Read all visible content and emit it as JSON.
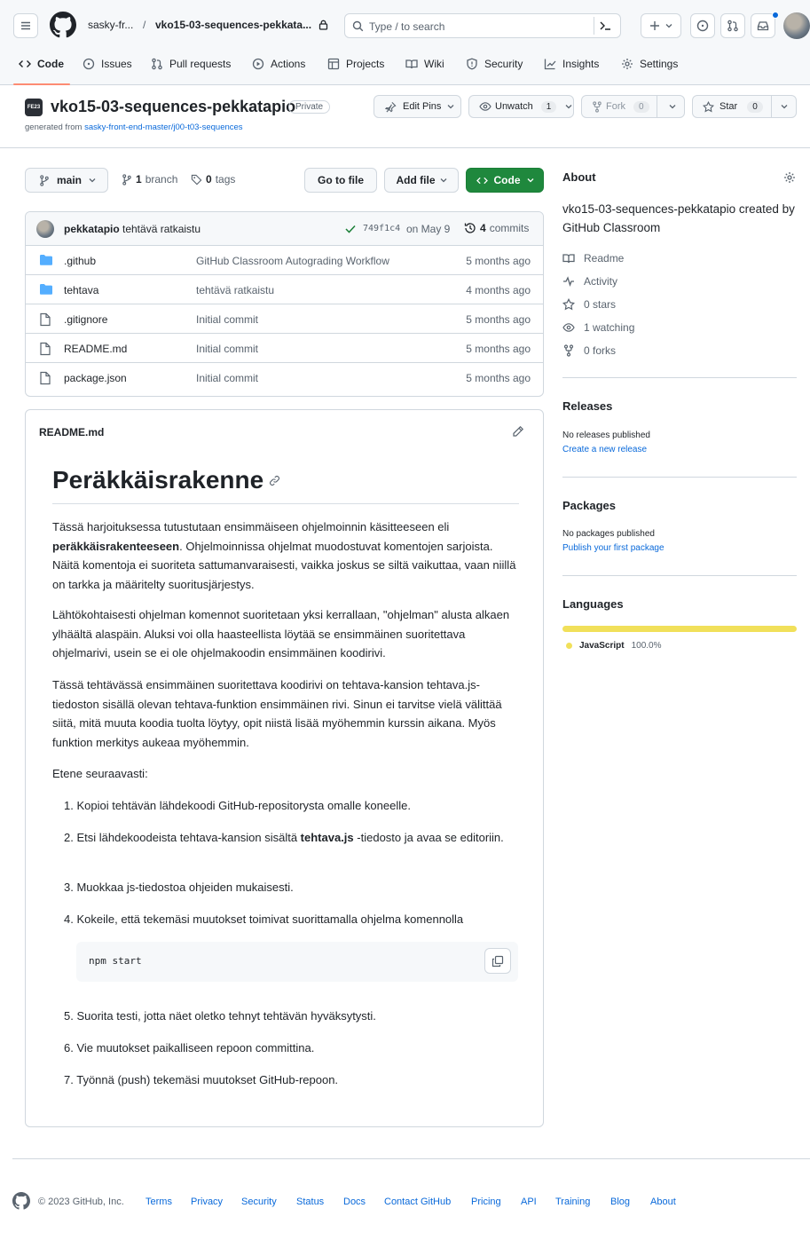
{
  "header": {
    "owner": "sasky-fr...",
    "separator": "/",
    "repo": "vko15-03-sequences-pekkata...",
    "search_placeholder": "Type / to search",
    "tabs": [
      {
        "label": "Code",
        "icon": "code-icon"
      },
      {
        "label": "Issues",
        "icon": "issue-icon"
      },
      {
        "label": "Pull requests",
        "icon": "pull-request-icon"
      },
      {
        "label": "Actions",
        "icon": "play-icon"
      },
      {
        "label": "Projects",
        "icon": "table-icon"
      },
      {
        "label": "Wiki",
        "icon": "book-icon"
      },
      {
        "label": "Security",
        "icon": "shield-icon"
      },
      {
        "label": "Insights",
        "icon": "graph-icon"
      },
      {
        "label": "Settings",
        "icon": "gear-icon"
      }
    ]
  },
  "repo": {
    "name": "vko15-03-sequences-pekkatapio",
    "visibility": "Private",
    "generated_prefix": "generated from",
    "generated_link": "sasky-front-end-master/j00-t03-sequences",
    "avatar_text": "FE23",
    "edit_pins": "Edit Pins",
    "unwatch": "Unwatch",
    "unwatch_count": "1",
    "fork": "Fork",
    "fork_count": "0",
    "star": "Star",
    "star_count": "0"
  },
  "toolbar": {
    "branch": "main",
    "branches_count": "1",
    "branches_label": "branch",
    "tags_count": "0",
    "tags_label": "tags",
    "go_to_file": "Go to file",
    "add_file": "Add file",
    "code": "Code"
  },
  "commit": {
    "author": "pekkatapio",
    "message": "tehtävä ratkaistu",
    "hash": "749f1c4",
    "date": "on May 9",
    "count": "4",
    "count_label": "commits"
  },
  "files": [
    {
      "name": ".github",
      "type": "folder",
      "message": "GitHub Classroom Autograding Workflow",
      "age": "5 months ago"
    },
    {
      "name": "tehtava",
      "type": "folder",
      "message": "tehtävä ratkaistu",
      "age": "4 months ago"
    },
    {
      "name": ".gitignore",
      "type": "file",
      "message": "Initial commit",
      "age": "5 months ago"
    },
    {
      "name": "README.md",
      "type": "file",
      "message": "Initial commit",
      "age": "5 months ago"
    },
    {
      "name": "package.json",
      "type": "file",
      "message": "Initial commit",
      "age": "5 months ago"
    }
  ],
  "readme": {
    "filename": "README.md",
    "title": "Peräkkäisrakenne",
    "p1_a": "Tässä harjoituksessa tutustutaan ensimmäiseen ohjelmoinnin käsitteeseen eli",
    "p1_bold": "peräkkäisrakenteeseen",
    "p1_b": ". Ohjelmoinnissa ohjelmat muodostuvat komentojen sarjoista. Näitä komentoja ei suoriteta sattumanvaraisesti, vaikka joskus se siltä vaikuttaa, vaan niillä on tarkka ja määritelty suoritusjärjestys.",
    "p2": "Lähtökohtaisesti ohjelman komennot suoritetaan yksi kerrallaan, \"ohjelman\" alusta alkaen ylhäältä alaspäin. Aluksi voi olla haasteellista löytää se ensimmäinen suoritettava ohjelmarivi, usein se ei ole ohjelmakoodin ensimmäinen koodirivi.",
    "p3": "Tässä tehtävässä ensimmäinen suoritettava koodirivi on tehtava-kansion tehtava.js-tiedoston sisällä olevan tehtava-funktion ensimmäinen rivi. Sinun ei tarvitse vielä välittää siitä, mitä muuta koodia tuolta löytyy, opit niistä lisää myöhemmin kurssin aikana. Myös funktion merkitys aukeaa myöhemmin.",
    "p4": "Etene seuraavasti:",
    "steps": [
      "1. Kopioi tehtävän lähdekoodi GitHub-repositorysta omalle koneelle.",
      "2. Etsi lähdekoodeista tehtava-kansion sisältä",
      "3. Muokkaa js-tiedostoa ohjeiden mukaisesti.",
      "4. Kokeile, että tekemäsi muutokset toimivat suorittamalla ohjelma komennolla",
      "5. Suorita testi, jotta näet oletko tehnyt tehtävän hyväksytysti.",
      "6. Vie muutokset paikalliseen repoon committina.",
      "7. Työnnä (push) tekemäsi muutokset GitHub-repoon."
    ],
    "step2_bold": "tehtava.js",
    "step2_tail": "-tiedosto ja avaa se editoriin.",
    "code": "npm start"
  },
  "about": {
    "heading": "About",
    "description": "vko15-03-sequences-pekkatapio created by GitHub Classroom",
    "readme": "Readme",
    "activity": "Activity",
    "stars": "0 stars",
    "watching": "1 watching",
    "forks": "0 forks"
  },
  "releases": {
    "heading": "Releases",
    "empty": "No releases published",
    "link": "Create a new release"
  },
  "packages": {
    "heading": "Packages",
    "empty": "No packages published",
    "link": "Publish your first package"
  },
  "languages": {
    "heading": "Languages",
    "name": "JavaScript",
    "percent": "100.0%",
    "fraction": 1.0,
    "color": "#f1e05a"
  },
  "footer": {
    "copyright": "© 2023 GitHub, Inc.",
    "links": [
      "Terms",
      "Privacy",
      "Security",
      "Status",
      "Docs",
      "Contact GitHub",
      "Pricing",
      "API",
      "Training",
      "Blog",
      "About"
    ]
  },
  "colors": {
    "accent": "#0969da",
    "primary_button": "#1f883d",
    "border": "#d0d7de",
    "muted": "#59636e"
  }
}
